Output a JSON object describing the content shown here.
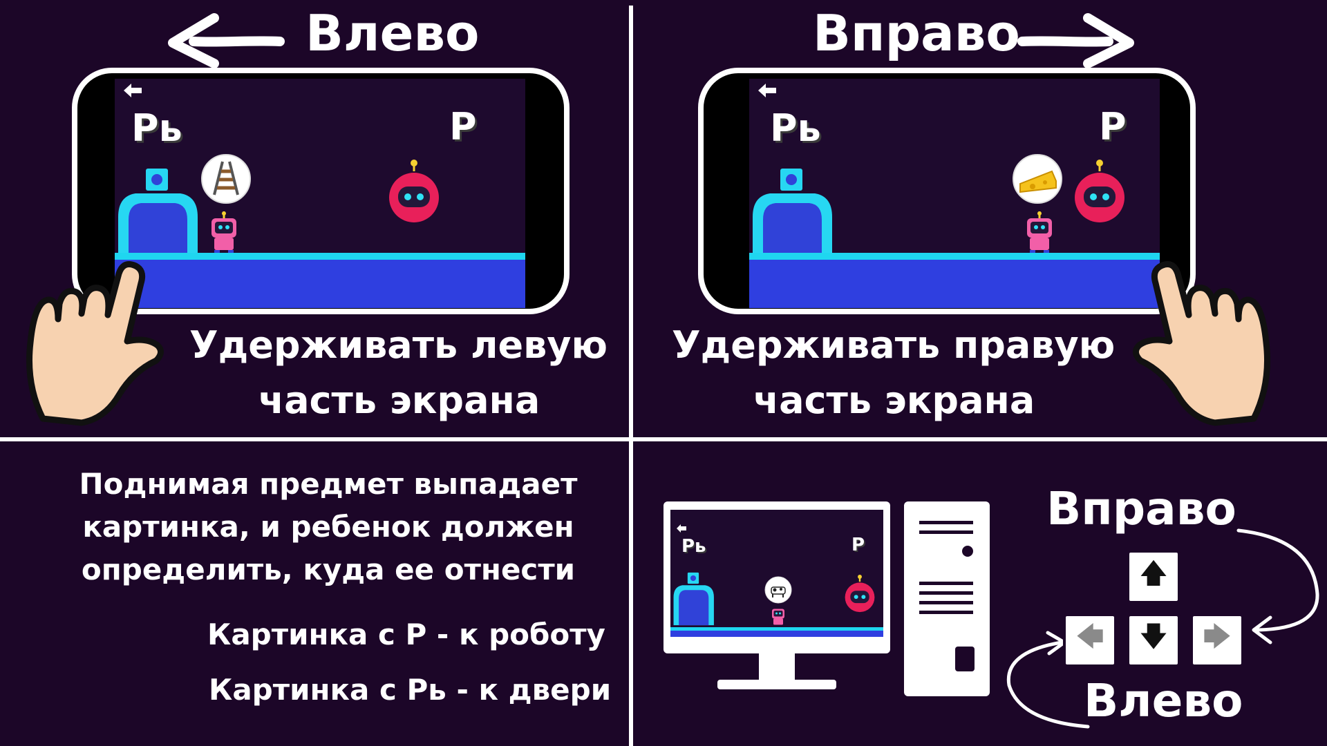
{
  "colors": {
    "background": "#1c0628",
    "screen_bg": "#1e0a2e",
    "floor": "#2f3fe0",
    "floor_top": "#1fd6f0",
    "door_frame": "#27d7f2",
    "door": "#3042d8",
    "robot_red": "#e8205a",
    "robot_face": "#23183a",
    "small_robot": "#f25fa8",
    "skin": "#f7d2b0",
    "white": "#ffffff"
  },
  "top_left": {
    "direction_title": "Влево",
    "instruction_line1": "Удерживать левую",
    "instruction_line2": "часть экрана",
    "letter_left": "Рь",
    "letter_right": "Р",
    "back_icon": "back-arrow-icon",
    "bubble_item": "rails-icon"
  },
  "top_right": {
    "direction_title": "Вправо",
    "instruction_line1": "Удерживать правую",
    "instruction_line2": "часть экрана",
    "letter_left": "Рь",
    "letter_right": "Р",
    "back_icon": "back-arrow-icon",
    "bubble_item": "cheese-icon"
  },
  "bottom_left": {
    "description_line1": "Поднимая предмет выпадает",
    "description_line2": "картинка, и ребенок должен",
    "description_line3": "определить, куда ее отнести",
    "rule_1": "Картинка с Р - к роботу",
    "rule_2": "Картинка с Рь - к двери"
  },
  "bottom_right": {
    "label_right": "Вправо",
    "label_left": "Влево",
    "monitor_letter_left": "Рь",
    "monitor_letter_right": "Р",
    "bubble_item": "cow-icon",
    "keys": {
      "up": "🡅",
      "left": "🡄",
      "down": "🡇",
      "right": "🡆"
    }
  }
}
